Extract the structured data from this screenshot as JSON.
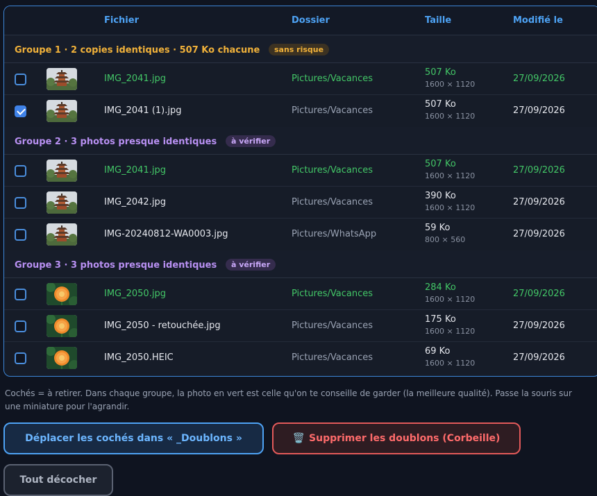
{
  "table": {
    "headers": {
      "file": "Fichier",
      "folder": "Dossier",
      "size": "Taille",
      "modified": "Modifié le"
    },
    "groups": [
      {
        "title": "Groupe 1 · 2 copies identiques · 507 Ko chacune",
        "badge": "sans risque",
        "rows": [
          {
            "file": "IMG_2041.jpg",
            "folder": "Pictures/Vacances",
            "size": "507 Ko",
            "dims": "1600 × 1120",
            "date": "27/09/2026",
            "checked": false,
            "keep": true,
            "thumb": "pagoda"
          },
          {
            "file": "IMG_2041 (1).jpg",
            "folder": "Pictures/Vacances",
            "size": "507 Ko",
            "dims": "1600 × 1120",
            "date": "27/09/2026",
            "checked": true,
            "keep": false,
            "thumb": "pagoda"
          }
        ]
      },
      {
        "title": "Groupe 2 · 3 photos presque identiques",
        "badge": "à vérifier",
        "rows": [
          {
            "file": "IMG_2041.jpg",
            "folder": "Pictures/Vacances",
            "size": "507 Ko",
            "dims": "1600 × 1120",
            "date": "27/09/2026",
            "checked": false,
            "keep": true,
            "thumb": "pagoda"
          },
          {
            "file": "IMG_2042.jpg",
            "folder": "Pictures/Vacances",
            "size": "390 Ko",
            "dims": "1600 × 1120",
            "date": "27/09/2026",
            "checked": false,
            "keep": false,
            "thumb": "pagoda"
          },
          {
            "file": "IMG-20240812-WA0003.jpg",
            "folder": "Pictures/WhatsApp",
            "size": "59 Ko",
            "dims": "800 × 560",
            "date": "27/09/2026",
            "checked": false,
            "keep": false,
            "thumb": "pagoda"
          }
        ]
      },
      {
        "title": "Groupe 3 · 3 photos presque identiques",
        "badge": "à vérifier",
        "rows": [
          {
            "file": "IMG_2050.jpg",
            "folder": "Pictures/Vacances",
            "size": "284 Ko",
            "dims": "1600 × 1120",
            "date": "27/09/2026",
            "checked": false,
            "keep": true,
            "thumb": "flower"
          },
          {
            "file": "IMG_2050 - retouchée.jpg",
            "folder": "Pictures/Vacances",
            "size": "175 Ko",
            "dims": "1600 × 1120",
            "date": "27/09/2026",
            "checked": false,
            "keep": false,
            "thumb": "flower"
          },
          {
            "file": "IMG_2050.HEIC",
            "folder": "Pictures/Vacances",
            "size": "69 Ko",
            "dims": "1600 × 1120",
            "date": "27/09/2026",
            "checked": false,
            "keep": false,
            "thumb": "flower"
          }
        ]
      }
    ]
  },
  "help_text": "Cochés = à retirer. Dans chaque groupe, la photo en vert est celle qu'on te conseille de garder (la meilleure qualité). Passe la souris sur une miniature pour l'agrandir.",
  "buttons": {
    "move": "Déplacer les cochés dans « _Doublons »",
    "delete": "Supprimer les doublons (Corbeille)",
    "delete_icon": "🗑️",
    "uncheck": "Tout décocher"
  },
  "colors": {
    "accent": "#4ea3f5",
    "keep_green": "#43c767",
    "danger": "#e35a5a",
    "safe_badge": "#f0b13a",
    "verify_badge": "#b890f2"
  }
}
